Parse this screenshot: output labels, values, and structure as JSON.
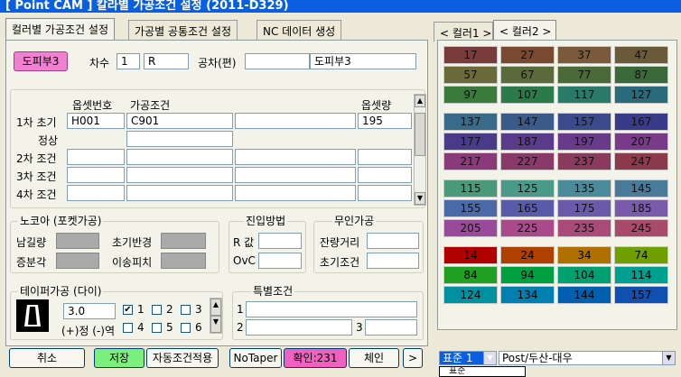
{
  "title": "[ Point CAM ]   칼라별 가공조건 설정   (2011-D329)",
  "left_tabs": [
    "컬러별 가공조건 설정",
    "가공별 공통조건 설정",
    "NC 데이터 생성"
  ],
  "right_tabs": [
    "< 컬러1 >",
    "< 컬러2 >"
  ],
  "header": {
    "part_button": "도피부3",
    "degree_label": "차수",
    "degree_value": "1",
    "side_value": "R",
    "tolerance_label": "공차(편)",
    "tolerance_value": "",
    "part_name": "도피부3"
  },
  "table": {
    "col_offset_no": "옵셋번호",
    "col_condition": "가공조건",
    "col_offset_amount": "옵셋량",
    "rows": [
      {
        "label": "1차 초기",
        "offset_no": "H001",
        "condition": "C901",
        "extra": "",
        "amount": "195"
      },
      {
        "label": "정상",
        "offset_no": "",
        "condition": "",
        "extra": "",
        "amount": ""
      },
      {
        "label": "2차 조건",
        "offset_no": "",
        "condition": "",
        "extra": "",
        "amount": ""
      },
      {
        "label": "3차 조건",
        "offset_no": "",
        "condition": "",
        "extra": "",
        "amount": ""
      },
      {
        "label": "4차 조건",
        "offset_no": "",
        "condition": "",
        "extra": "",
        "amount": ""
      }
    ]
  },
  "nozzle": {
    "title": "노코아 (포켓가공)",
    "remain": "남길량",
    "init_diameter": "초기반경",
    "incr_angle": "증분각",
    "move_pitch": "이송피치"
  },
  "approach": {
    "title": "진입방법",
    "r_label": "R 값",
    "r_value": "",
    "ovc_label": "OvC",
    "ovc_value": ""
  },
  "unmanned": {
    "title": "무인가공",
    "remain_dist": "잔량거리",
    "remain_dist_value": "",
    "init_cond": "초기조건",
    "init_cond_value": ""
  },
  "taper": {
    "title": "테이퍼가공 (다이)",
    "value": "3.0",
    "direction": "(+)정 (-)역",
    "checks": [
      {
        "n": "1",
        "c": "✔"
      },
      {
        "n": "2",
        "c": ""
      },
      {
        "n": "3",
        "c": ""
      },
      {
        "n": "4",
        "c": ""
      },
      {
        "n": "5",
        "c": ""
      },
      {
        "n": "6",
        "c": ""
      }
    ]
  },
  "special": {
    "title": "특별조건",
    "n1": "1",
    "n2": "2",
    "n3": "3",
    "v1": "",
    "v2": "",
    "v3": ""
  },
  "buttons": {
    "cancel": "취소",
    "save": "저장",
    "auto": "자동조건적용",
    "notaper": "NoTaper",
    "confirm": "확인:231",
    "chain": "체인",
    "next": ">"
  },
  "colors": {
    "accent_green": "#7cf07c",
    "accent_pink": "#f060c0"
  },
  "palette": [
    {
      "v": "17",
      "c": "#7a3b3b"
    },
    {
      "v": "27",
      "c": "#7a4a30"
    },
    {
      "v": "37",
      "c": "#7a5a3a"
    },
    {
      "v": "47",
      "c": "#6a5a3a"
    },
    {
      "v": "57",
      "c": "#6a6a3a"
    },
    {
      "v": "67",
      "c": "#5a6a3a"
    },
    {
      "v": "77",
      "c": "#4a6a3a"
    },
    {
      "v": "87",
      "c": "#3a6a3a"
    },
    {
      "v": "97",
      "c": "#3a7a3a"
    },
    {
      "v": "107",
      "c": "#2a7a4a"
    },
    {
      "v": "117",
      "c": "#2a7a6a"
    },
    {
      "v": "127",
      "c": "#2a6a7a"
    },
    {
      "v": "137",
      "c": "#3a6a8a"
    },
    {
      "v": "147",
      "c": "#3a5a8a"
    },
    {
      "v": "157",
      "c": "#3a4a8a"
    },
    {
      "v": "167",
      "c": "#3a3a8a"
    },
    {
      "v": "177",
      "c": "#4a3a8a"
    },
    {
      "v": "187",
      "c": "#5a3a8a"
    },
    {
      "v": "197",
      "c": "#6a3a8a"
    },
    {
      "v": "207",
      "c": "#7a3a8a"
    },
    {
      "v": "217",
      "c": "#8a3a7a"
    },
    {
      "v": "227",
      "c": "#8a3a6a"
    },
    {
      "v": "237",
      "c": "#8a3a5a"
    },
    {
      "v": "247",
      "c": "#8a3a4a"
    },
    {
      "v": "115",
      "c": "#4a9a7a"
    },
    {
      "v": "125",
      "c": "#4a9a8a"
    },
    {
      "v": "135",
      "c": "#4a8a9a"
    },
    {
      "v": "145",
      "c": "#4a7a9a"
    },
    {
      "v": "155",
      "c": "#4a6aaa"
    },
    {
      "v": "165",
      "c": "#5a5aaa"
    },
    {
      "v": "175",
      "c": "#6a5aaa"
    },
    {
      "v": "185",
      "c": "#7a5aaa"
    },
    {
      "v": "205",
      "c": "#9a4a9a"
    },
    {
      "v": "225",
      "c": "#aa4a8a"
    },
    {
      "v": "235",
      "c": "#aa4a7a"
    },
    {
      "v": "245",
      "c": "#aa4a6a"
    },
    {
      "v": "14",
      "c": "#b00000"
    },
    {
      "v": "24",
      "c": "#b04000"
    },
    {
      "v": "34",
      "c": "#b07000"
    },
    {
      "v": "74",
      "c": "#70a000"
    },
    {
      "v": "84",
      "c": "#20a020"
    },
    {
      "v": "94",
      "c": "#00a040"
    },
    {
      "v": "104",
      "c": "#00a070"
    },
    {
      "v": "114",
      "c": "#00a090"
    },
    {
      "v": "124",
      "c": "#0090a0"
    },
    {
      "v": "134",
      "c": "#0080b0"
    },
    {
      "v": "144",
      "c": "#0060b0"
    },
    {
      "v": "157",
      "c": "#1050b0"
    }
  ],
  "bottom": {
    "select1": "표준 1",
    "select2": "Post/두산-대우",
    "dropdown_option": "표준"
  }
}
